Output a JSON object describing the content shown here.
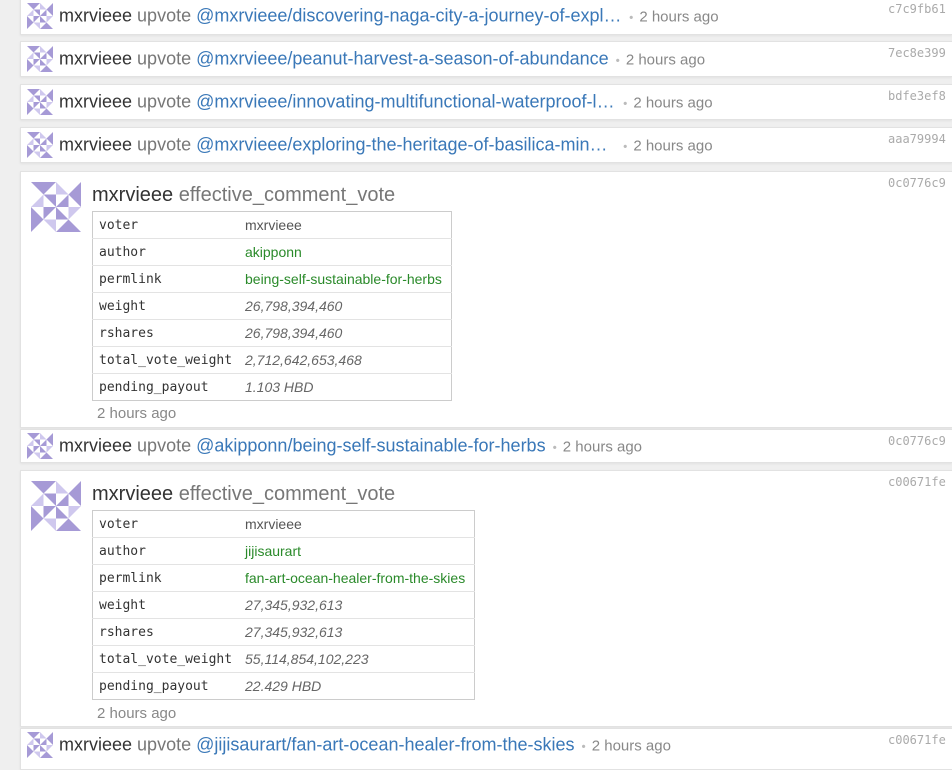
{
  "colors": {
    "link": "#3a78b8",
    "green": "#2a8a2a",
    "muted": "#888888",
    "background": "#efefef"
  },
  "avatar_icon": "identicon-avatar",
  "ops": [
    {
      "kind": "upvote",
      "user": "mxrvieee",
      "verb": "upvote",
      "link": "@mxrvieee/discovering-naga-city-a-journey-of-explo…",
      "time": "2 hours ago",
      "hash": "c7c9fb61"
    },
    {
      "kind": "upvote",
      "user": "mxrvieee",
      "verb": "upvote",
      "link": "@mxrvieee/peanut-harvest-a-season-of-abundance",
      "time": "2 hours ago",
      "hash": "7ec8e399"
    },
    {
      "kind": "upvote",
      "user": "mxrvieee",
      "verb": "upvote",
      "link": "@mxrvieee/innovating-multifunctional-waterproof-la…",
      "time": "2 hours ago",
      "hash": "bdfe3ef8"
    },
    {
      "kind": "upvote",
      "user": "mxrvieee",
      "verb": "upvote",
      "link": "@mxrvieee/exploring-the-heritage-of-basilica-minor…",
      "time": "2 hours ago",
      "hash": "aaa79994"
    },
    {
      "kind": "effective",
      "user": "mxrvieee",
      "op_name": "effective_comment_vote",
      "time": "2 hours ago",
      "hash": "0c0776c9",
      "fields": [
        {
          "key": "voter",
          "value": "mxrvieee"
        },
        {
          "key": "author",
          "value": "akipponn"
        },
        {
          "key": "permlink",
          "value": "being-self-sustainable-for-herbs"
        },
        {
          "key": "weight",
          "value": "26,798,394,460"
        },
        {
          "key": "rshares",
          "value": "26,798,394,460"
        },
        {
          "key": "total_vote_weight",
          "value": "2,712,642,653,468"
        },
        {
          "key": "pending_payout",
          "value": "1.103 HBD"
        }
      ]
    },
    {
      "kind": "upvote",
      "user": "mxrvieee",
      "verb": "upvote",
      "link": "@akipponn/being-self-sustainable-for-herbs",
      "time": "2 hours ago",
      "hash": "0c0776c9"
    },
    {
      "kind": "effective",
      "user": "mxrvieee",
      "op_name": "effective_comment_vote",
      "time": "2 hours ago",
      "hash": "c00671fe",
      "fields": [
        {
          "key": "voter",
          "value": "mxrvieee"
        },
        {
          "key": "author",
          "value": "jijisaurart"
        },
        {
          "key": "permlink",
          "value": "fan-art-ocean-healer-from-the-skies"
        },
        {
          "key": "weight",
          "value": "27,345,932,613"
        },
        {
          "key": "rshares",
          "value": "27,345,932,613"
        },
        {
          "key": "total_vote_weight",
          "value": "55,114,854,102,223"
        },
        {
          "key": "pending_payout",
          "value": "22.429 HBD"
        }
      ]
    },
    {
      "kind": "upvote",
      "user": "mxrvieee",
      "verb": "upvote",
      "link": "@jijisaurart/fan-art-ocean-healer-from-the-skies",
      "time": "2 hours ago",
      "hash": "c00671fe"
    }
  ]
}
